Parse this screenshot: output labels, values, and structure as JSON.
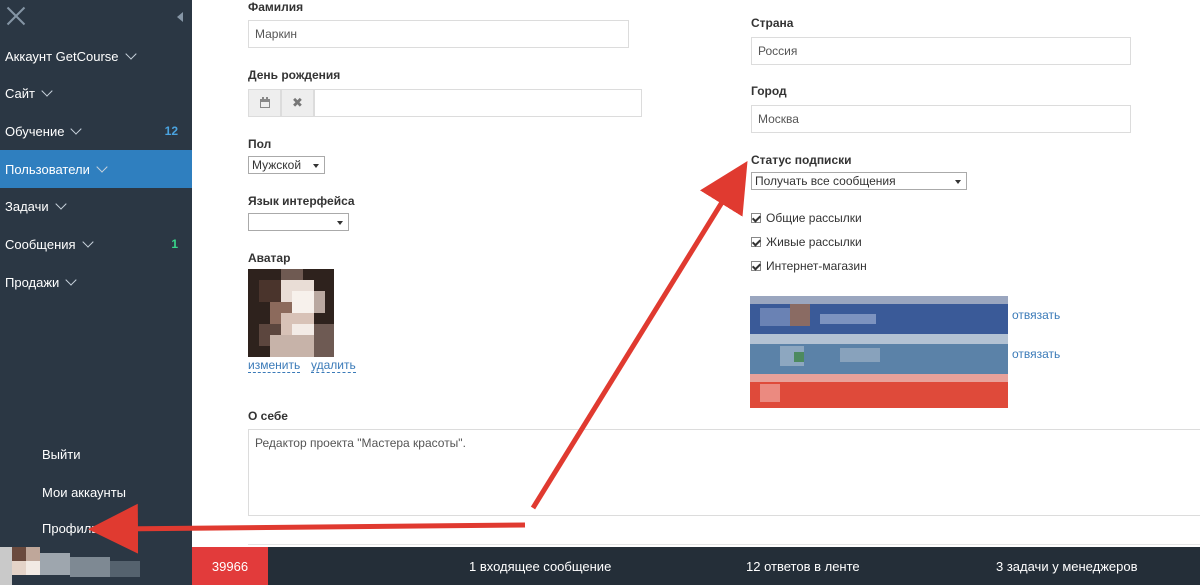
{
  "sidebar": {
    "items": [
      {
        "label": "Аккаунт GetCourse",
        "badge": ""
      },
      {
        "label": "Сайт",
        "badge": ""
      },
      {
        "label": "Обучение",
        "badge": "12"
      },
      {
        "label": "Пользователи",
        "badge": ""
      },
      {
        "label": "Задачи",
        "badge": ""
      },
      {
        "label": "Сообщения",
        "badge": "1"
      },
      {
        "label": "Продажи",
        "badge": ""
      }
    ],
    "bottom": {
      "logout": "Выйти",
      "my_accounts": "Мои аккаунты",
      "profile": "Профиль"
    }
  },
  "form": {
    "last_name": {
      "label": "Фамилия",
      "value": "Маркин"
    },
    "birthday": {
      "label": "День рождения",
      "value": ""
    },
    "gender": {
      "label": "Пол",
      "value": "Мужской"
    },
    "language": {
      "label": "Язык интерфейса",
      "value": ""
    },
    "avatar": {
      "label": "Аватар",
      "change": "изменить",
      "delete": "удалить"
    },
    "about": {
      "label": "О себе",
      "value": "Редактор проекта \"Мастера красоты\"."
    },
    "country": {
      "label": "Страна",
      "value": "Россия"
    },
    "city": {
      "label": "Город",
      "value": "Москва"
    },
    "subscription": {
      "label": "Статус подписки",
      "value": "Получать все сообщения",
      "checkboxes": [
        "Общие рассылки",
        "Живые рассылки",
        "Интернет-магазин"
      ]
    },
    "social": {
      "unlink_1": "отвязать",
      "unlink_2": "отвязать"
    }
  },
  "bottombar": {
    "count": "39966",
    "incoming": "1 входящее сообщение",
    "feed": "12 ответов в ленте",
    "tasks": "3 задачи у менеджеров"
  },
  "colors": {
    "sidebar_bg": "#2b3744",
    "active_item": "#2f7fbf",
    "badge_blue": "#4aa3e0",
    "badge_green": "#38d68a",
    "bottombar_bg": "#242e38",
    "counter_red": "#e23b3b",
    "annotation_arrow": "#e03a30",
    "link": "#3a7ab8"
  },
  "icons": {
    "close": "close-icon",
    "collapse": "collapse-left-icon",
    "calendar": "calendar-icon",
    "clear": "clear-icon"
  }
}
